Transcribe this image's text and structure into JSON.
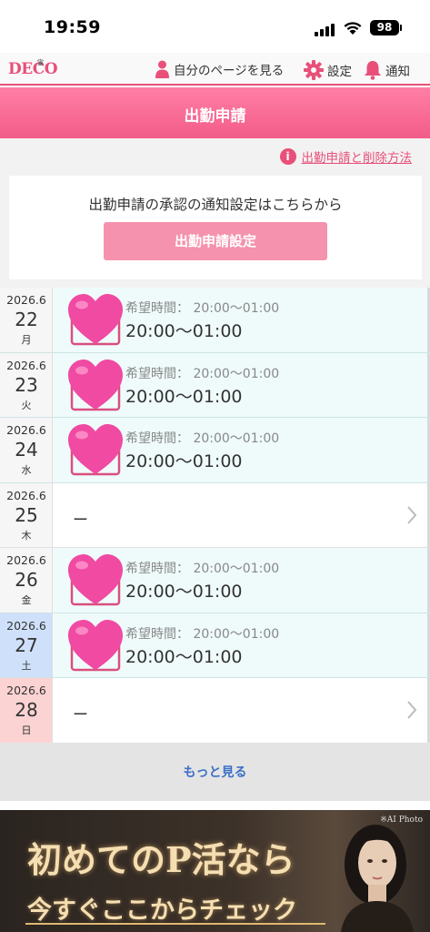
{
  "status_bar": {
    "time": "19:59",
    "battery": "98"
  },
  "header": {
    "logo": "DECO",
    "my_page": "自分のページを見る",
    "settings": "設定",
    "notifications": "通知"
  },
  "page_title": "出勤申請",
  "method_link": "出勤申請と削除方法",
  "notice": {
    "text": "出勤申請の承認の通知設定はこちらから",
    "button": "出勤申請設定"
  },
  "schedule": [
    {
      "ym": "2026.6",
      "day": "22",
      "weekday": "月",
      "label": "希望時間：",
      "label_time": "20:00〜01:00",
      "time": "20:00〜01:00"
    },
    {
      "ym": "2026.6",
      "day": "23",
      "weekday": "火",
      "label": "希望時間：",
      "label_time": "20:00〜01:00",
      "time": "20:00〜01:00"
    },
    {
      "ym": "2026.6",
      "day": "24",
      "weekday": "水",
      "label": "希望時間：",
      "label_time": "20:00〜01:00",
      "time": "20:00〜01:00"
    },
    {
      "ym": "2026.6",
      "day": "25",
      "weekday": "木",
      "empty": "ー"
    },
    {
      "ym": "2026.6",
      "day": "26",
      "weekday": "金",
      "label": "希望時間：",
      "label_time": "20:00〜01:00",
      "time": "20:00〜01:00"
    },
    {
      "ym": "2026.6",
      "day": "27",
      "weekday": "土",
      "label": "希望時間：",
      "label_time": "20:00〜01:00",
      "time": "20:00〜01:00"
    },
    {
      "ym": "2026.6",
      "day": "28",
      "weekday": "日",
      "empty": "ー"
    }
  ],
  "more": "もっと見る",
  "ad": {
    "line1": "初めてのP活なら",
    "line2": "今すぐここからチェック",
    "note": "※AI Photo"
  },
  "colors": {
    "accent": "#e8507a",
    "banner": "#f25c88",
    "button": "#f592ad",
    "link": "#3a6fc7"
  }
}
